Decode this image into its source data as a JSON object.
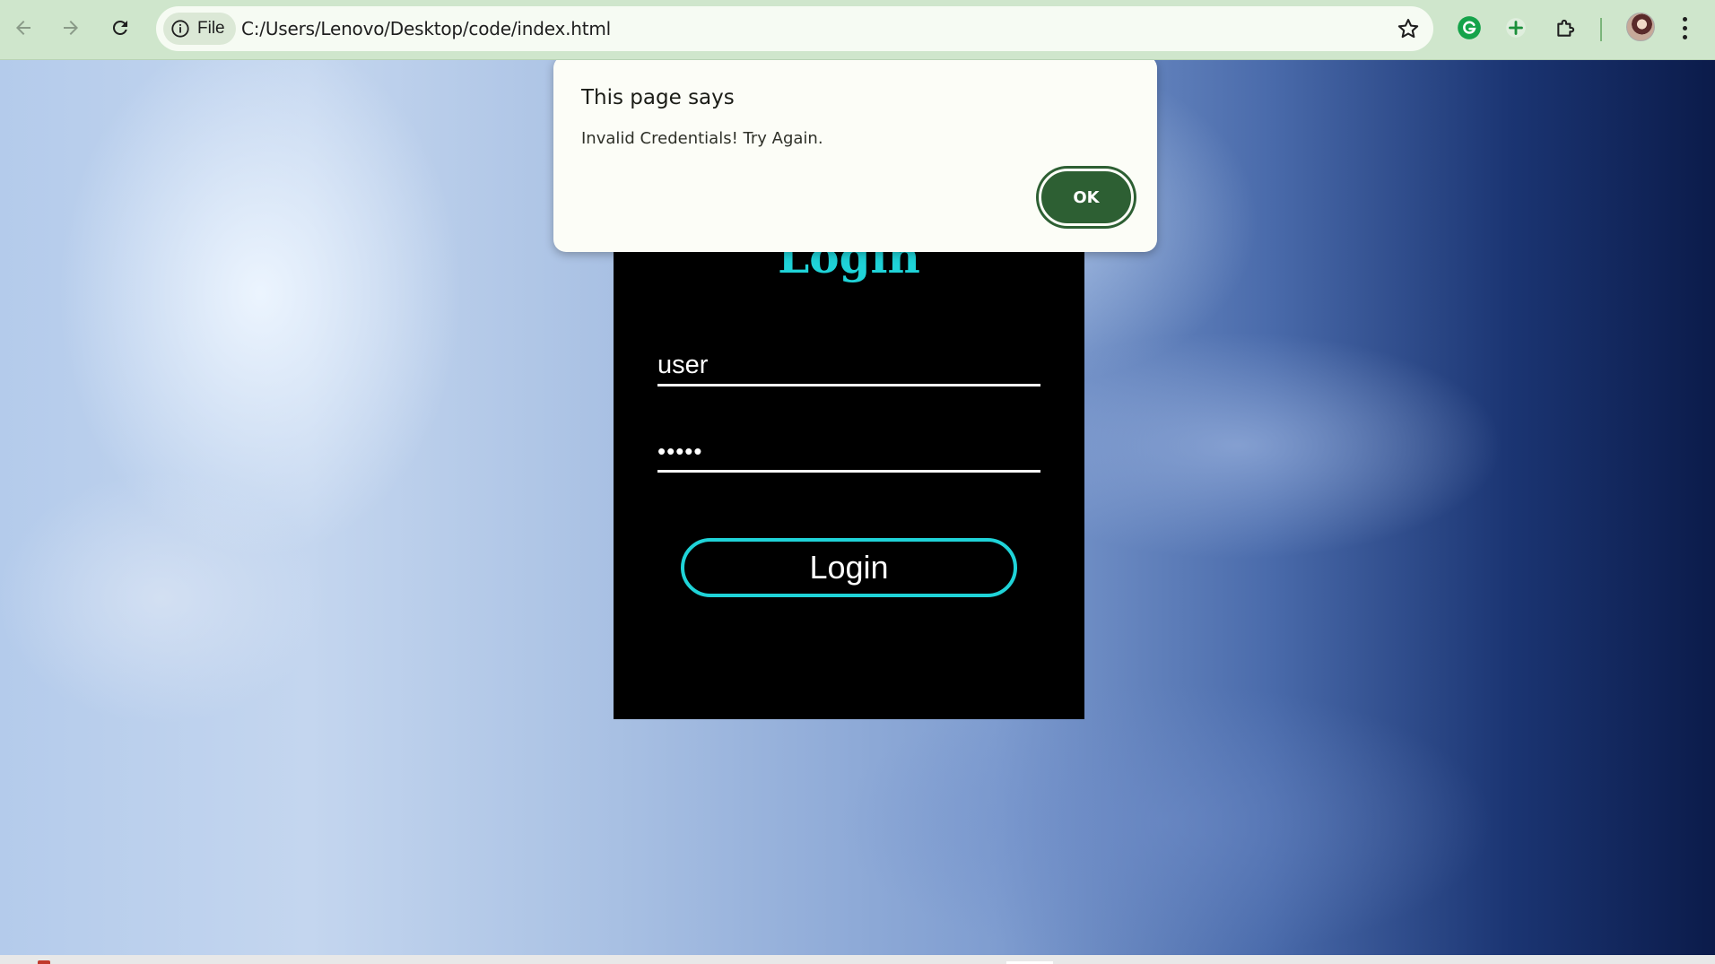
{
  "browser": {
    "site_info_label": "File",
    "url": "C:/Users/Lenovo/Desktop/code/index.html"
  },
  "page": {
    "login_title": "Login",
    "username_value": "user",
    "password_value": "•••••",
    "login_button_label": "Login"
  },
  "dialog": {
    "title": "This page says",
    "message": "Invalid Credentials! Try Again.",
    "ok_label": "OK"
  },
  "colors": {
    "toolbar": "#cfe6cc",
    "accent_cyan": "#1fd3d8",
    "dialog_button": "#2d5f33"
  }
}
